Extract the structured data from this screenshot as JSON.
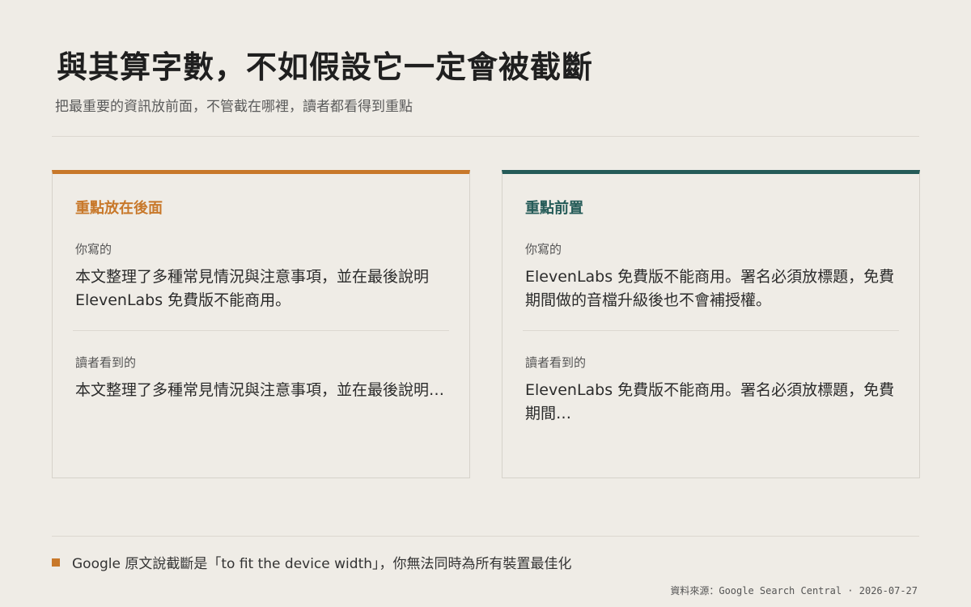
{
  "header": {
    "title": "與其算字數，不如假設它一定會被截斷",
    "subtitle": "把最重要的資訊放前面，不管截在哪裡，讀者都看得到重點"
  },
  "cards": [
    {
      "heading": "重點放在後面",
      "accent_color": "#c8782a",
      "written_label": "你寫的",
      "written_text": "本文整理了多種常見情況與注意事項，並在最後說明 ElevenLabs 免費版不能商用。",
      "seen_label": "讀者看到的",
      "seen_text": "本文整理了多種常見情況與注意事項，並在最後說明…"
    },
    {
      "heading": "重點前置",
      "accent_color": "#255b58",
      "written_label": "你寫的",
      "written_text": "ElevenLabs 免費版不能商用。署名必須放標題，免費期間做的音檔升級後也不會補授權。",
      "seen_label": "讀者看到的",
      "seen_text": "ElevenLabs 免費版不能商用。署名必須放標題，免費期間…"
    }
  ],
  "footnote": {
    "text": "Google 原文說截斷是「to fit the device width」，你無法同時為所有裝置最佳化"
  },
  "source": "資料來源：Google Search Central · 2026-07-27"
}
